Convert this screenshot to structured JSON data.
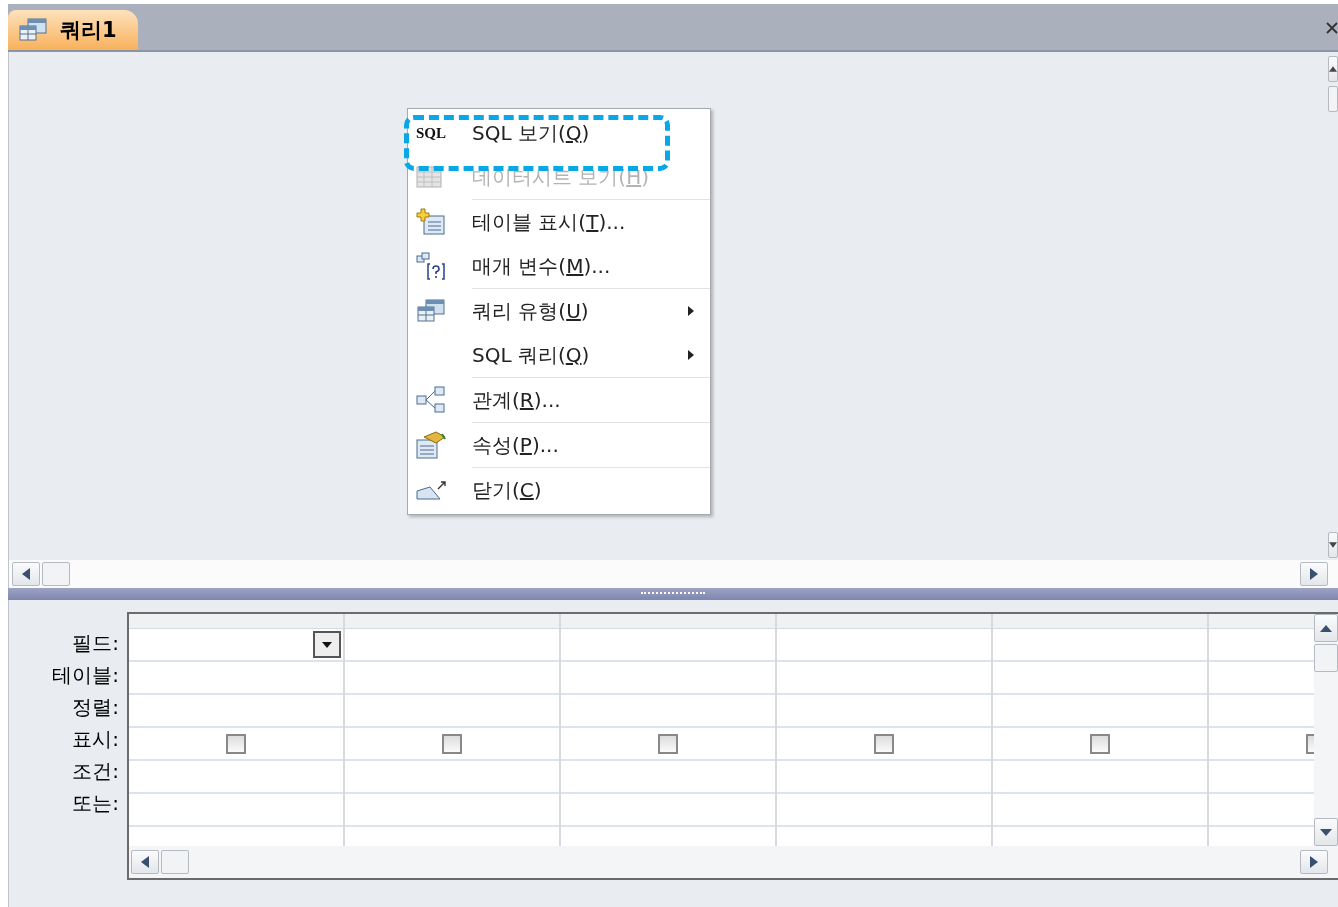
{
  "tab": {
    "title": "쿼리1",
    "selected": true
  },
  "context_menu": {
    "items": [
      {
        "kind": "sql",
        "icon_text": "SQL",
        "label": "SQL 보기(",
        "key": "Q",
        "tail": ")",
        "disabled": false,
        "highlighted": true,
        "separator_before": false,
        "submenu": false
      },
      {
        "kind": "datasheet",
        "label": "데이터시트 보기(",
        "key": "H",
        "tail": ")",
        "disabled": true,
        "highlighted": false,
        "separator_before": false,
        "submenu": false
      },
      {
        "kind": "show-table",
        "label": "테이블 표시(",
        "key": "T",
        "tail": ")...",
        "disabled": false,
        "highlighted": false,
        "separator_before": true,
        "submenu": false
      },
      {
        "kind": "parameters",
        "label": "매개 변수(",
        "key": "M",
        "tail": ")...",
        "disabled": false,
        "highlighted": false,
        "separator_before": false,
        "submenu": false
      },
      {
        "kind": "query-type",
        "label": "쿼리 유형(",
        "key": "U",
        "tail": ")",
        "disabled": false,
        "highlighted": false,
        "separator_before": true,
        "submenu": true
      },
      {
        "kind": "plain",
        "label": "SQL 쿼리(",
        "key": "Q",
        "tail": ")",
        "disabled": false,
        "highlighted": false,
        "separator_before": false,
        "submenu": true
      },
      {
        "kind": "relationships",
        "label": "관계(",
        "key": "R",
        "tail": ")...",
        "disabled": false,
        "highlighted": false,
        "separator_before": true,
        "submenu": false
      },
      {
        "kind": "properties",
        "label": "속성(",
        "key": "P",
        "tail": ")...",
        "disabled": false,
        "highlighted": false,
        "separator_before": true,
        "submenu": false
      },
      {
        "kind": "close",
        "label": "닫기(",
        "key": "C",
        "tail": ")",
        "disabled": false,
        "highlighted": false,
        "separator_before": true,
        "submenu": false
      }
    ]
  },
  "design_grid": {
    "row_labels": [
      "필드:",
      "테이블:",
      "정렬:",
      "표시:",
      "조건:",
      "또는:"
    ],
    "columns": [
      {
        "show": false,
        "active": true
      },
      {
        "show": false,
        "active": false
      },
      {
        "show": false,
        "active": false
      },
      {
        "show": false,
        "active": false
      },
      {
        "show": false,
        "active": false
      },
      {
        "show": false,
        "active": false
      }
    ]
  }
}
